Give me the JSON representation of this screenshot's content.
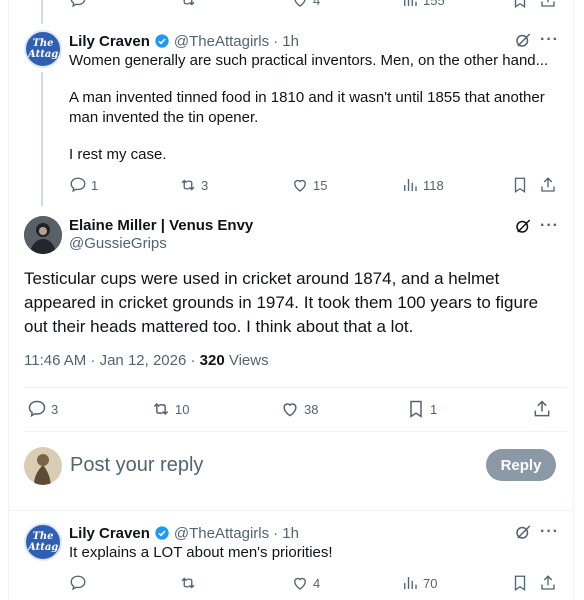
{
  "top_actions": {
    "replies": "",
    "reposts": "",
    "likes": "4",
    "views": "155"
  },
  "reply1": {
    "name": "Lily Craven",
    "handle": "@TheAttagirls",
    "time": "· 1h",
    "avatar_text": "The Attag",
    "p1": "Women generally are such practical inventors. Men, on the other hand...",
    "p2": "A man invented tinned food in 1810 and it wasn't until 1855 that another man invented the tin opener.",
    "p3": "I rest my case.",
    "replies": "1",
    "reposts": "3",
    "likes": "15",
    "views": "118"
  },
  "main": {
    "name": "Elaine Miller | Venus Envy",
    "handle": "@GussieGrips",
    "text": "Testicular cups were used in cricket around 1874,  and a helmet appeared in cricket grounds in 1974.  It took them 100 years to figure out their heads mattered too.  I think about that a lot.",
    "timestamp": "11:46 AM · Jan 12, 2026 · ",
    "views_count": "320",
    "views_label": " Views",
    "replies": "3",
    "reposts": "10",
    "likes": "38",
    "bookmarks": "1"
  },
  "composer": {
    "placeholder": "Post your reply",
    "button": "Reply"
  },
  "reply2": {
    "name": "Lily Craven",
    "handle": "@TheAttagirls",
    "time": "· 1h",
    "avatar_text": "The Attag",
    "text": "It explains a LOT about men's priorities!",
    "replies": "",
    "reposts": "",
    "likes": "4",
    "views": "70"
  },
  "colors": {
    "accent": "#1d9bf0",
    "muted": "#536471",
    "reply_button": "#8b98a5"
  }
}
